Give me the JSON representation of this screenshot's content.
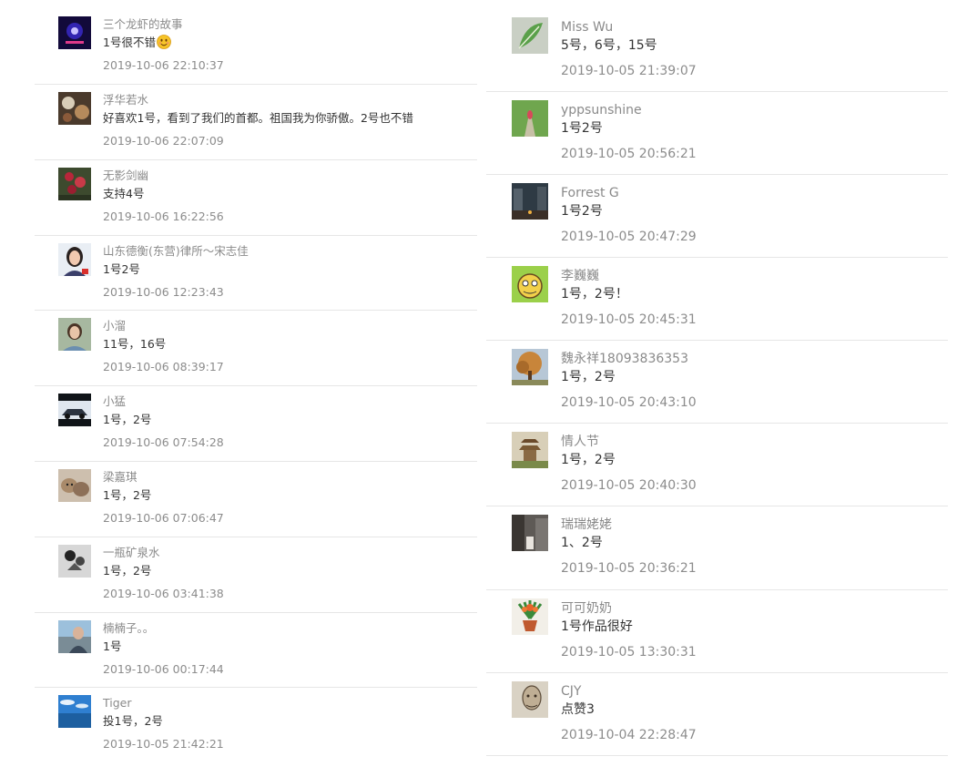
{
  "left_comments": [
    {
      "nickname": "三个龙虾的故事",
      "content": "1号很不错",
      "emoji": "smiley-face-icon",
      "time": "2019-10-06 22:10:37",
      "avatar": "night-stage-avatar"
    },
    {
      "nickname": "浮华若水",
      "content": "好喜欢1号，看到了我们的首都。祖国我为你骄傲。2号也不错",
      "time": "2019-10-06 22:07:09",
      "avatar": "food-table-avatar"
    },
    {
      "nickname": "无影剑幽",
      "content": "支持4号",
      "time": "2019-10-06 16:22:56",
      "avatar": "red-flowers-avatar"
    },
    {
      "nickname": "山东德衡(东营)律所～宋志佳",
      "content": "1号2号",
      "time": "2019-10-06 12:23:43",
      "avatar": "woman-portrait-avatar"
    },
    {
      "nickname": "小溜",
      "content": "11号，16号",
      "time": "2019-10-06 08:39:17",
      "avatar": "outdoor-portrait-avatar"
    },
    {
      "nickname": "小猛",
      "content": "1号，2号",
      "time": "2019-10-06 07:54:28",
      "avatar": "car-avatar"
    },
    {
      "nickname": "梁嘉琪",
      "content": "1号，2号",
      "time": "2019-10-06 07:06:47",
      "avatar": "cats-avatar"
    },
    {
      "nickname": "一瓶矿泉水",
      "content": "1号，2号",
      "time": "2019-10-06 03:41:38",
      "avatar": "cartoon-avatar"
    },
    {
      "nickname": "楠楠子。。",
      "content": "1号",
      "time": "2019-10-06 00:17:44",
      "avatar": "seaside-portrait-avatar"
    },
    {
      "nickname": "Tiger",
      "content": "投1号，2号",
      "time": "2019-10-05 21:42:21",
      "avatar": "sea-sky-avatar"
    }
  ],
  "right_comments": [
    {
      "nickname": "Miss Wu",
      "content": "5号，6号，15号",
      "time": "2019-10-05 21:39:07",
      "avatar": "green-leaf-avatar"
    },
    {
      "nickname": "yppsunshine",
      "content": "1号2号",
      "time": "2019-10-05 20:56:21",
      "avatar": "garden-path-avatar"
    },
    {
      "nickname": "Forrest G",
      "content": "1号2号",
      "time": "2019-10-05 20:47:29",
      "avatar": "city-street-avatar"
    },
    {
      "nickname": "李巍巍",
      "content": "1号，2号！",
      "time": "2019-10-05 20:45:31",
      "avatar": "cartoon-character-avatar"
    },
    {
      "nickname": "魏永祥18093836353",
      "content": "1号，2号",
      "time": "2019-10-05 20:43:10",
      "avatar": "autumn-tree-avatar"
    },
    {
      "nickname": "情人节",
      "content": "1号，2号",
      "time": "2019-10-05 20:40:30",
      "avatar": "pagoda-avatar"
    },
    {
      "nickname": "瑞瑞姥姥",
      "content": "1、2号",
      "time": "2019-10-05 20:36:21",
      "avatar": "street-scene-avatar"
    },
    {
      "nickname": "可可奶奶",
      "content": "1号作品很好",
      "time": "2019-10-05 13:30:31",
      "avatar": "potted-plant-avatar"
    },
    {
      "nickname": "CJY",
      "content": "点赞3",
      "time": "2019-10-04 22:28:47",
      "avatar": "sketch-portrait-avatar"
    }
  ]
}
